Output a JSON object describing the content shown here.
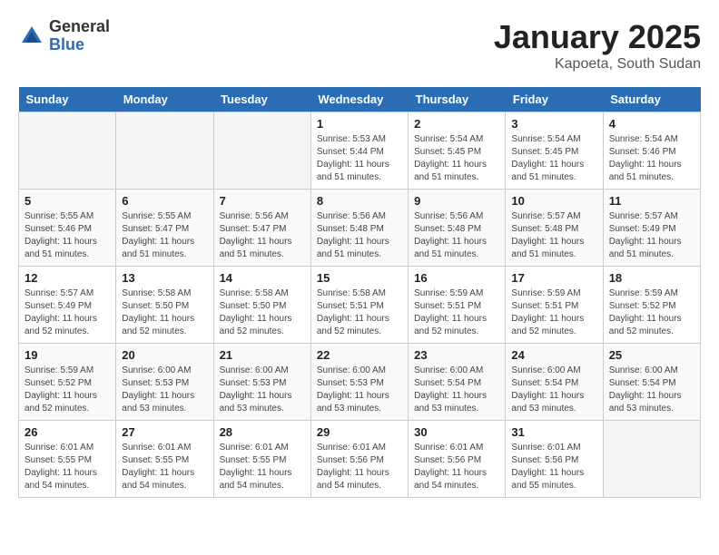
{
  "header": {
    "logo_general": "General",
    "logo_blue": "Blue",
    "title": "January 2025",
    "subtitle": "Kapoeta, South Sudan"
  },
  "days_of_week": [
    "Sunday",
    "Monday",
    "Tuesday",
    "Wednesday",
    "Thursday",
    "Friday",
    "Saturday"
  ],
  "weeks": [
    [
      {
        "day": "",
        "info": ""
      },
      {
        "day": "",
        "info": ""
      },
      {
        "day": "",
        "info": ""
      },
      {
        "day": "1",
        "info": "Sunrise: 5:53 AM\nSunset: 5:44 PM\nDaylight: 11 hours\nand 51 minutes."
      },
      {
        "day": "2",
        "info": "Sunrise: 5:54 AM\nSunset: 5:45 PM\nDaylight: 11 hours\nand 51 minutes."
      },
      {
        "day": "3",
        "info": "Sunrise: 5:54 AM\nSunset: 5:45 PM\nDaylight: 11 hours\nand 51 minutes."
      },
      {
        "day": "4",
        "info": "Sunrise: 5:54 AM\nSunset: 5:46 PM\nDaylight: 11 hours\nand 51 minutes."
      }
    ],
    [
      {
        "day": "5",
        "info": "Sunrise: 5:55 AM\nSunset: 5:46 PM\nDaylight: 11 hours\nand 51 minutes."
      },
      {
        "day": "6",
        "info": "Sunrise: 5:55 AM\nSunset: 5:47 PM\nDaylight: 11 hours\nand 51 minutes."
      },
      {
        "day": "7",
        "info": "Sunrise: 5:56 AM\nSunset: 5:47 PM\nDaylight: 11 hours\nand 51 minutes."
      },
      {
        "day": "8",
        "info": "Sunrise: 5:56 AM\nSunset: 5:48 PM\nDaylight: 11 hours\nand 51 minutes."
      },
      {
        "day": "9",
        "info": "Sunrise: 5:56 AM\nSunset: 5:48 PM\nDaylight: 11 hours\nand 51 minutes."
      },
      {
        "day": "10",
        "info": "Sunrise: 5:57 AM\nSunset: 5:48 PM\nDaylight: 11 hours\nand 51 minutes."
      },
      {
        "day": "11",
        "info": "Sunrise: 5:57 AM\nSunset: 5:49 PM\nDaylight: 11 hours\nand 51 minutes."
      }
    ],
    [
      {
        "day": "12",
        "info": "Sunrise: 5:57 AM\nSunset: 5:49 PM\nDaylight: 11 hours\nand 52 minutes."
      },
      {
        "day": "13",
        "info": "Sunrise: 5:58 AM\nSunset: 5:50 PM\nDaylight: 11 hours\nand 52 minutes."
      },
      {
        "day": "14",
        "info": "Sunrise: 5:58 AM\nSunset: 5:50 PM\nDaylight: 11 hours\nand 52 minutes."
      },
      {
        "day": "15",
        "info": "Sunrise: 5:58 AM\nSunset: 5:51 PM\nDaylight: 11 hours\nand 52 minutes."
      },
      {
        "day": "16",
        "info": "Sunrise: 5:59 AM\nSunset: 5:51 PM\nDaylight: 11 hours\nand 52 minutes."
      },
      {
        "day": "17",
        "info": "Sunrise: 5:59 AM\nSunset: 5:51 PM\nDaylight: 11 hours\nand 52 minutes."
      },
      {
        "day": "18",
        "info": "Sunrise: 5:59 AM\nSunset: 5:52 PM\nDaylight: 11 hours\nand 52 minutes."
      }
    ],
    [
      {
        "day": "19",
        "info": "Sunrise: 5:59 AM\nSunset: 5:52 PM\nDaylight: 11 hours\nand 52 minutes."
      },
      {
        "day": "20",
        "info": "Sunrise: 6:00 AM\nSunset: 5:53 PM\nDaylight: 11 hours\nand 53 minutes."
      },
      {
        "day": "21",
        "info": "Sunrise: 6:00 AM\nSunset: 5:53 PM\nDaylight: 11 hours\nand 53 minutes."
      },
      {
        "day": "22",
        "info": "Sunrise: 6:00 AM\nSunset: 5:53 PM\nDaylight: 11 hours\nand 53 minutes."
      },
      {
        "day": "23",
        "info": "Sunrise: 6:00 AM\nSunset: 5:54 PM\nDaylight: 11 hours\nand 53 minutes."
      },
      {
        "day": "24",
        "info": "Sunrise: 6:00 AM\nSunset: 5:54 PM\nDaylight: 11 hours\nand 53 minutes."
      },
      {
        "day": "25",
        "info": "Sunrise: 6:00 AM\nSunset: 5:54 PM\nDaylight: 11 hours\nand 53 minutes."
      }
    ],
    [
      {
        "day": "26",
        "info": "Sunrise: 6:01 AM\nSunset: 5:55 PM\nDaylight: 11 hours\nand 54 minutes."
      },
      {
        "day": "27",
        "info": "Sunrise: 6:01 AM\nSunset: 5:55 PM\nDaylight: 11 hours\nand 54 minutes."
      },
      {
        "day": "28",
        "info": "Sunrise: 6:01 AM\nSunset: 5:55 PM\nDaylight: 11 hours\nand 54 minutes."
      },
      {
        "day": "29",
        "info": "Sunrise: 6:01 AM\nSunset: 5:56 PM\nDaylight: 11 hours\nand 54 minutes."
      },
      {
        "day": "30",
        "info": "Sunrise: 6:01 AM\nSunset: 5:56 PM\nDaylight: 11 hours\nand 54 minutes."
      },
      {
        "day": "31",
        "info": "Sunrise: 6:01 AM\nSunset: 5:56 PM\nDaylight: 11 hours\nand 55 minutes."
      },
      {
        "day": "",
        "info": ""
      }
    ]
  ]
}
